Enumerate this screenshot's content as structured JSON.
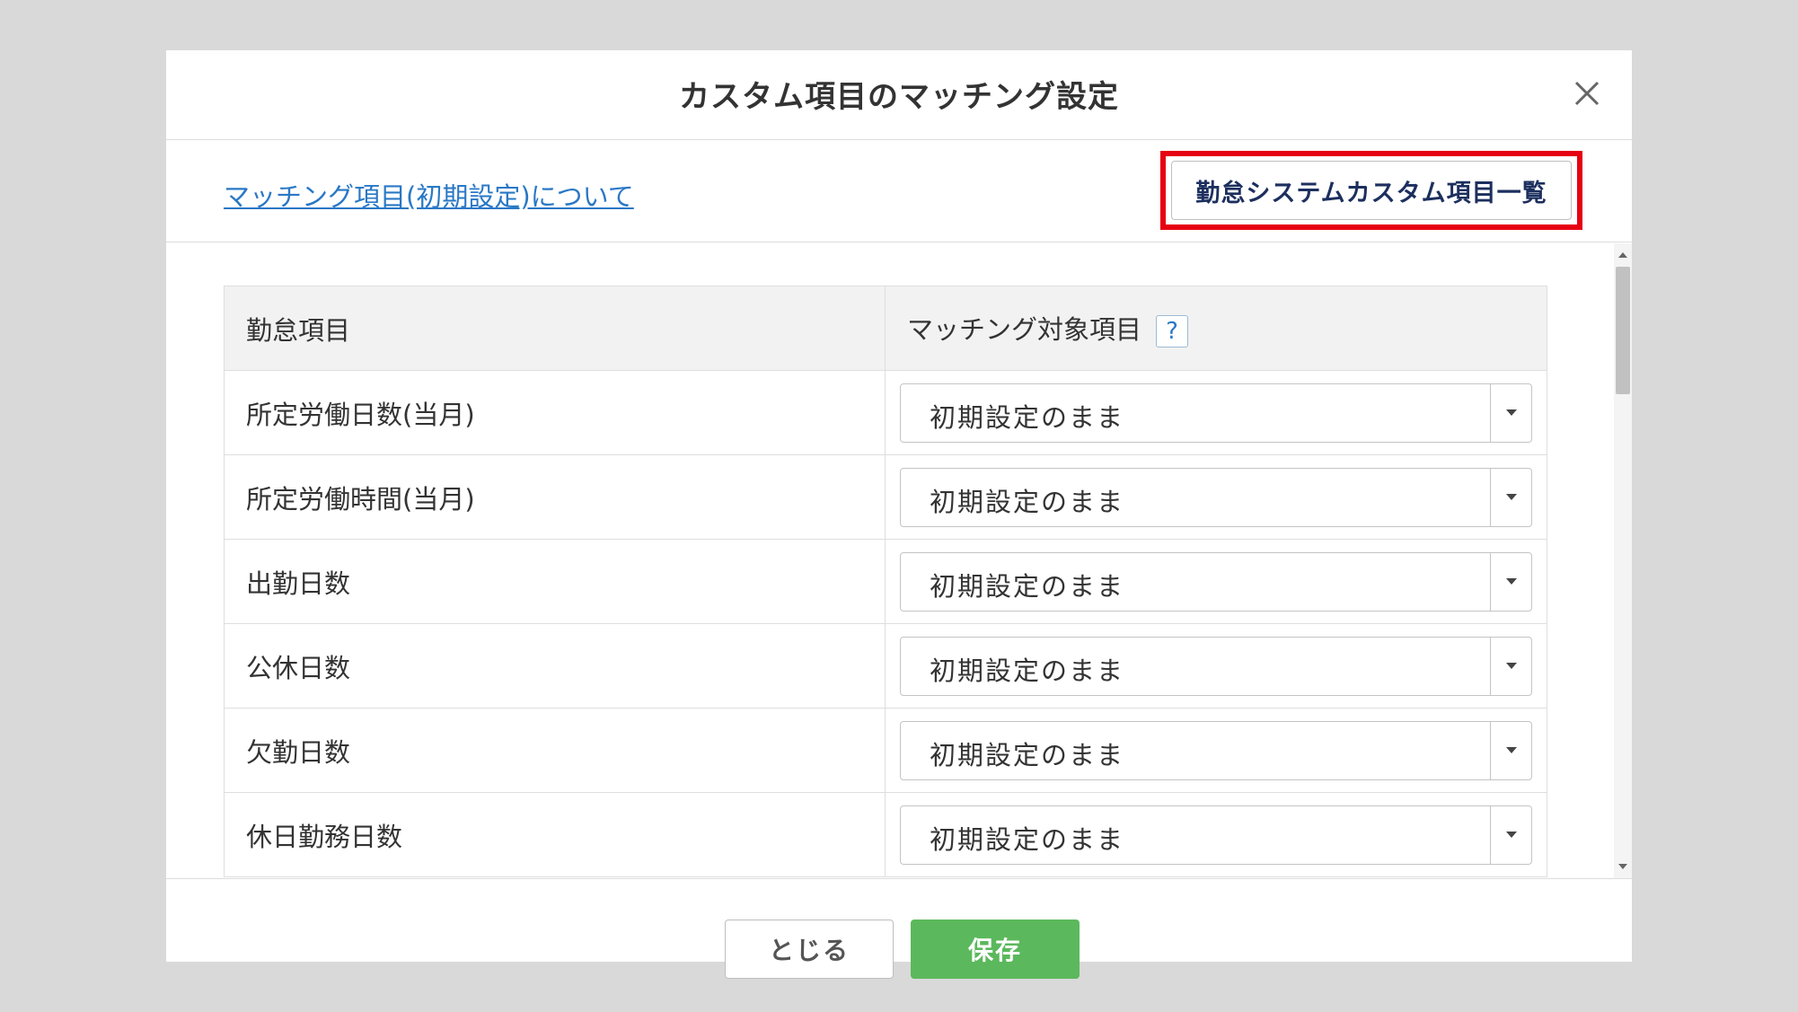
{
  "dialog": {
    "title": "カスタム項目のマッチング設定",
    "close_icon": "close-icon"
  },
  "subheader": {
    "help_link": "マッチング項目(初期設定)について",
    "list_button": "勤怠システムカスタム項目一覧",
    "highlight_color": "#e60012"
  },
  "table": {
    "headers": {
      "item": "勤怠項目",
      "match": "マッチング対象項目",
      "help_badge": "?"
    },
    "rows": [
      {
        "label": "所定労働日数(当月)",
        "value": "初期設定のまま"
      },
      {
        "label": "所定労働時間(当月)",
        "value": "初期設定のまま"
      },
      {
        "label": "出勤日数",
        "value": "初期設定のまま"
      },
      {
        "label": "公休日数",
        "value": "初期設定のまま"
      },
      {
        "label": "欠勤日数",
        "value": "初期設定のまま"
      },
      {
        "label": "休日勤務日数",
        "value": "初期設定のまま"
      }
    ]
  },
  "footer": {
    "close_button": "とじる",
    "save_button": "保存",
    "save_color": "#5cb85c"
  }
}
